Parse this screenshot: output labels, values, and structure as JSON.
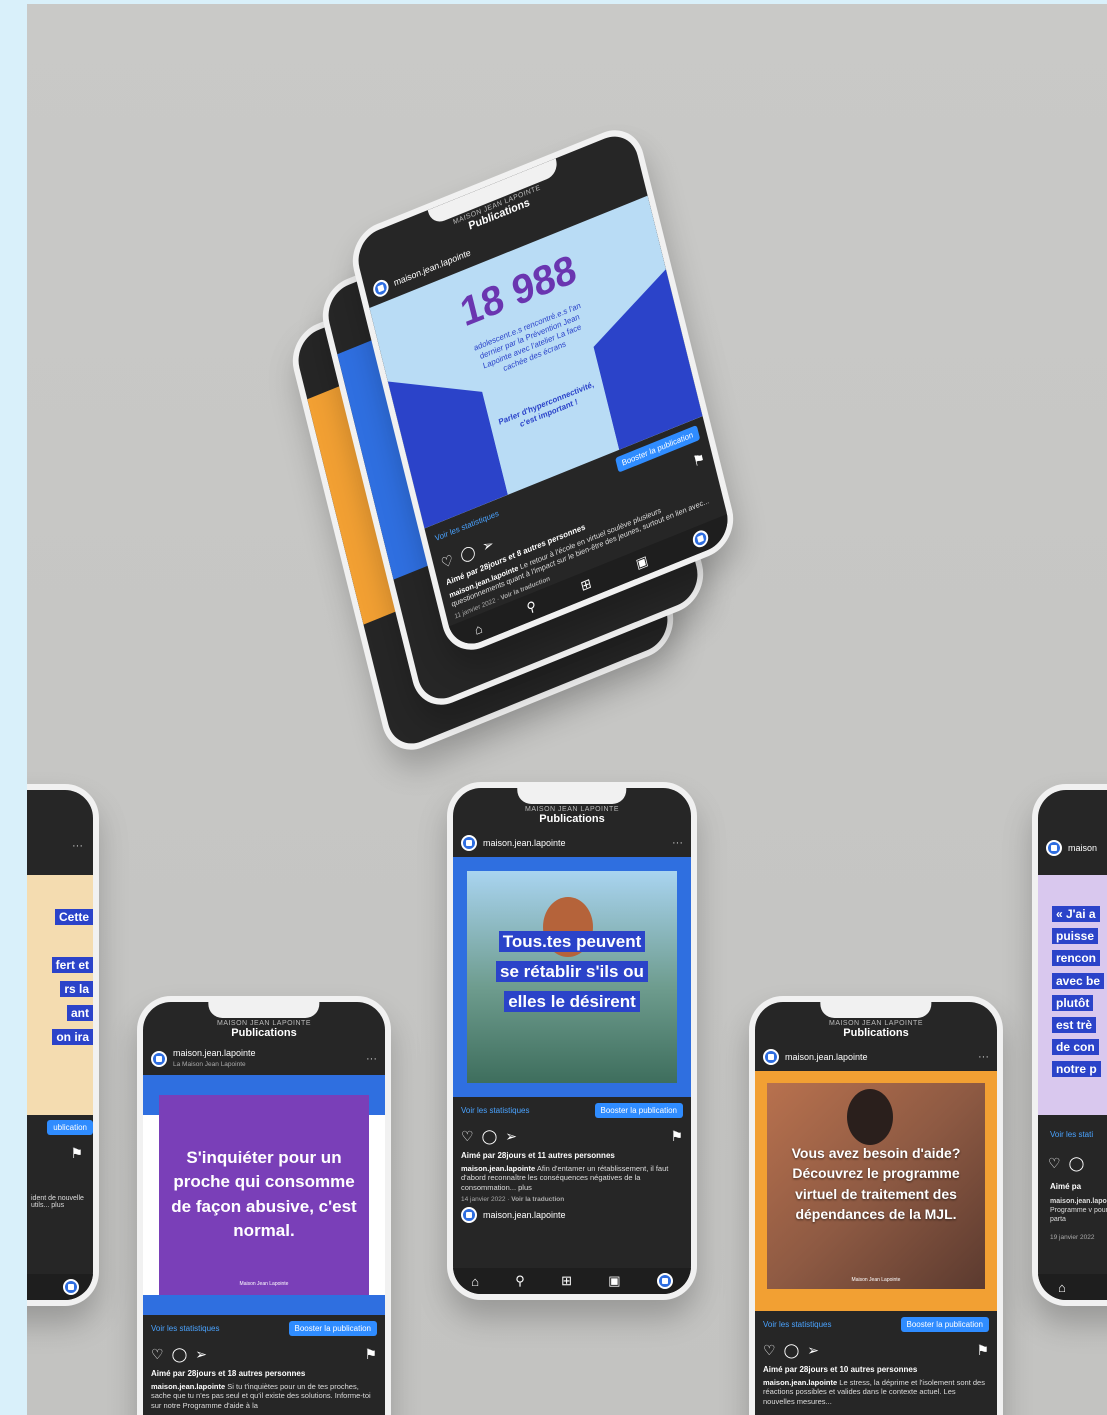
{
  "common": {
    "brand": "MAISON JEAN LAPOINTE",
    "header_title": "Publications",
    "account": "maison.jean.lapointe",
    "account_sub": "La Maison Jean Lapointe",
    "stats_link": "Voir les statistiques",
    "boost_button": "Booster la publication",
    "translate": "Voir la traduction",
    "more": "plus"
  },
  "top_phone": {
    "big_number": "18 988",
    "body": "adolescent.e.s rencontré.e.s l'an dernier par la Prévention Jean Lapointe avec l'atelier La face cachée des écrans",
    "body2": "Parler d'hyperconnectivité, c'est important !",
    "likes": "Aimé par 28jours et 8 autres personnes",
    "caption": "Le retour à l'école en virtuel soulève plusieurs questionnements quant à l'impact sur le bien-être des jeunes, surtout en lien avec...",
    "date": "11 janvier 2022"
  },
  "phone_left": {
    "headline": "S'inquiéter pour un proche qui consomme de façon abusive, c'est normal.",
    "likes": "Aimé par 28jours et 18 autres personnes",
    "caption": "Si tu t'inquiètes pour un de tes proches, sache que tu n'es pas seul et qu'il existe des solutions. Informe-toi sur notre Programme d'aide à la",
    "logo_text": "Maison Jean Lapointe"
  },
  "phone_center": {
    "headline_lines": [
      "Tous.tes peuvent",
      "se rétablir s'ils ou",
      "elles le désirent"
    ],
    "likes": "Aimé par 28jours et 11 autres personnes",
    "caption": "Afin d'entamer un rétablissement, il faut d'abord reconnaître les conséquences négatives de la consommation...",
    "date": "14 janvier 2022"
  },
  "phone_right": {
    "headline": "Vous avez besoin d'aide? Découvrez le programme virtuel de traitement des dépendances de la MJL.",
    "likes": "Aimé par 28jours et 10 autres personnes",
    "caption": "Le stress, la déprime et l'isolement sont des réactions possibles et valides dans le contexte actuel. Les nouvelles mesures...",
    "logo_text": "Maison Jean Lapointe"
  },
  "partial_left": {
    "lines": [
      "Cette",
      "fert et",
      "rs la",
      "ant",
      "on ira"
    ],
    "boost_fragment": "ublication",
    "likes_fragment": "utres",
    "caption_fragment": "ident de nouvelle utils...",
    "more": "plus"
  },
  "partial_right": {
    "lines": [
      "« J'ai a",
      "puisse",
      "rencon",
      "avec be",
      "plutôt",
      "est trè",
      "de con",
      "notre p"
    ],
    "stats_fragment": "Voir les stati",
    "likes_fragment": "Aimé pa",
    "caption_fragment": "Programme v pour ce parta",
    "date_fragment": "19 janvier 2022",
    "account_fragment": "maison"
  },
  "colors": {
    "instagram_dark": "#262626",
    "brand_blue": "#2b43c9",
    "light_blue": "#b9dcf5",
    "purple": "#7a3fb8",
    "orange": "#f2a033",
    "boost_blue": "#2f8cff"
  },
  "icons": [
    "heart-icon",
    "comment-icon",
    "share-icon",
    "bookmark-icon",
    "home-icon",
    "search-icon",
    "add-icon",
    "reels-icon",
    "back-icon",
    "more-icon"
  ]
}
